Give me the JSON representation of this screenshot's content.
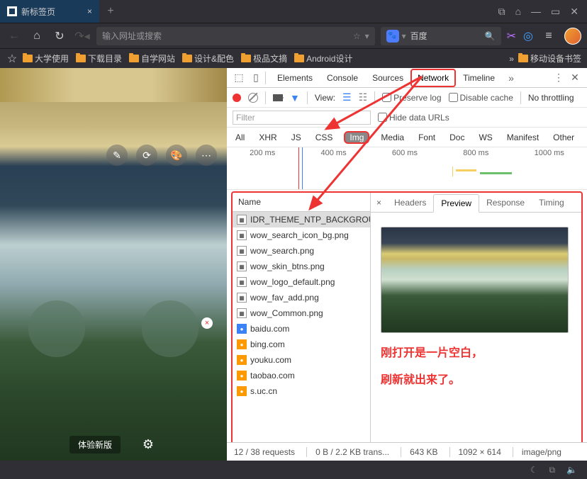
{
  "titlebar": {
    "tab_title": "新标签页"
  },
  "nav": {
    "address_placeholder": "输入网址或搜索",
    "search_engine": "百度"
  },
  "bookmarks": {
    "items": [
      "大学使用",
      "下载目录",
      "自学网站",
      "设计&配色",
      "极品文摘",
      "Android设计"
    ],
    "mobile": "移动设备书签"
  },
  "devtools": {
    "tabs": [
      "Elements",
      "Console",
      "Sources",
      "Network",
      "Timeline"
    ],
    "active_tab": "Network",
    "view_label": "View:",
    "preserve_log": "Preserve log",
    "disable_cache": "Disable cache",
    "throttle": "No throttling",
    "filter_placeholder": "Filter",
    "hide_data_label": "Hide data URLs",
    "types": [
      "All",
      "XHR",
      "JS",
      "CSS",
      "Img",
      "Media",
      "Font",
      "Doc",
      "WS",
      "Manifest",
      "Other"
    ],
    "active_type": "Img",
    "timeline_ticks": [
      "200 ms",
      "400 ms",
      "600 ms",
      "800 ms",
      "1000 ms"
    ],
    "name_header": "Name",
    "requests": [
      {
        "icon": "img",
        "name": "IDR_THEME_NTP_BACKGROUN...",
        "sel": true
      },
      {
        "icon": "img",
        "name": "wow_search_icon_bg.png"
      },
      {
        "icon": "img",
        "name": "wow_search.png"
      },
      {
        "icon": "img",
        "name": "wow_skin_btns.png"
      },
      {
        "icon": "img",
        "name": "wow_logo_default.png"
      },
      {
        "icon": "img",
        "name": "wow_fav_add.png"
      },
      {
        "icon": "img",
        "name": "wow_Common.png"
      },
      {
        "icon": "baidu",
        "name": "baidu.com"
      },
      {
        "icon": "orange",
        "name": "bing.com"
      },
      {
        "icon": "orange",
        "name": "youku.com"
      },
      {
        "icon": "orange",
        "name": "taobao.com"
      },
      {
        "icon": "orange",
        "name": "s.uc.cn"
      }
    ],
    "preview_tabs": [
      "Headers",
      "Preview",
      "Response",
      "Timing"
    ],
    "active_preview_tab": "Preview",
    "status": {
      "requests": "12 / 38 requests",
      "transferred": "0 B / 2.2 KB trans...",
      "size": "643 KB",
      "dims": "1092 × 614",
      "mime": "image/png"
    }
  },
  "ntp": {
    "version_btn": "体验新版"
  },
  "annotations": {
    "line1": "刚打开是一片空白，",
    "line2": "刷新就出来了。"
  }
}
